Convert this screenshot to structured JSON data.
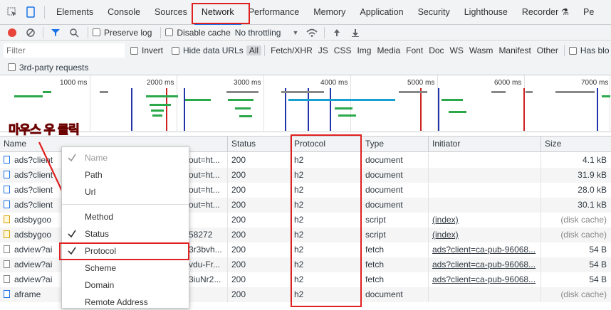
{
  "tabs": [
    "Elements",
    "Console",
    "Sources",
    "Network",
    "Performance",
    "Memory",
    "Application",
    "Security",
    "Lighthouse",
    "Recorder",
    "Pe"
  ],
  "toolbar": {
    "preserve_log": "Preserve log",
    "disable_cache": "Disable cache",
    "throttle": "No throttling"
  },
  "filter": {
    "placeholder": "Filter",
    "invert": "Invert",
    "hide_urls": "Hide data URLs",
    "types": [
      "All",
      "Fetch/XHR",
      "JS",
      "CSS",
      "Img",
      "Media",
      "Font",
      "Doc",
      "WS",
      "Wasm",
      "Manifest",
      "Other"
    ],
    "has_blocked": "Has blo",
    "third_party": "3rd-party requests"
  },
  "overview": {
    "ticks": [
      "1000 ms",
      "2000 ms",
      "3000 ms",
      "4000 ms",
      "5000 ms",
      "6000 ms",
      "7000 ms"
    ]
  },
  "annotation": "마우스 우 클릭",
  "columns": {
    "name": "Name",
    "status": "Status",
    "protocol": "Protocol",
    "type": "Type",
    "initiator": "Initiator",
    "size": "Size"
  },
  "rows": [
    {
      "name": "ads?client",
      "url": "out=ht...",
      "status": "200",
      "protocol": "h2",
      "type": "document",
      "initiator": "",
      "size": "4.1 kB",
      "ft": "doc"
    },
    {
      "name": "ads?client",
      "url": "out=ht...",
      "status": "200",
      "protocol": "h2",
      "type": "document",
      "initiator": "",
      "size": "31.9 kB",
      "ft": "doc"
    },
    {
      "name": "ads?client",
      "url": "out=ht...",
      "status": "200",
      "protocol": "h2",
      "type": "document",
      "initiator": "",
      "size": "28.0 kB",
      "ft": "doc"
    },
    {
      "name": "ads?client",
      "url": "out=ht...",
      "status": "200",
      "protocol": "h2",
      "type": "document",
      "initiator": "",
      "size": "30.1 kB",
      "ft": "doc"
    },
    {
      "name": "adsbygoo",
      "url": "",
      "status": "200",
      "protocol": "h2",
      "type": "script",
      "initiator": "(index)",
      "size": "(disk cache)",
      "ft": "script"
    },
    {
      "name": "adsbygoo",
      "url": "58272",
      "status": "200",
      "protocol": "h2",
      "type": "script",
      "initiator": "(index)",
      "size": "(disk cache)",
      "ft": "script"
    },
    {
      "name": "adview?ai",
      "url": "3r3bvh...",
      "status": "200",
      "protocol": "h2",
      "type": "fetch",
      "initiator": "ads?client=ca-pub-96068...",
      "size": "54 B",
      "ft": "fetch"
    },
    {
      "name": "adview?ai",
      "url": "vdu-Fr...",
      "status": "200",
      "protocol": "h2",
      "type": "fetch",
      "initiator": "ads?client=ca-pub-96068...",
      "size": "54 B",
      "ft": "fetch"
    },
    {
      "name": "adview?ai",
      "url": "3iuNr2...",
      "status": "200",
      "protocol": "h2",
      "type": "fetch",
      "initiator": "ads?client=ca-pub-96068...",
      "size": "54 B",
      "ft": "fetch"
    },
    {
      "name": "aframe",
      "url": "",
      "status": "200",
      "protocol": "h2",
      "type": "document",
      "initiator": "",
      "size": "(disk cache)",
      "ft": "doc"
    }
  ],
  "menu": [
    {
      "label": "Name",
      "checked": true,
      "disabled": true
    },
    {
      "label": "Path",
      "checked": false
    },
    {
      "label": "Url",
      "checked": false
    },
    {
      "label": "Method",
      "checked": false
    },
    {
      "label": "Status",
      "checked": true
    },
    {
      "label": "Protocol",
      "checked": true
    },
    {
      "label": "Scheme",
      "checked": false
    },
    {
      "label": "Domain",
      "checked": false
    },
    {
      "label": "Remote Address",
      "checked": false
    }
  ]
}
